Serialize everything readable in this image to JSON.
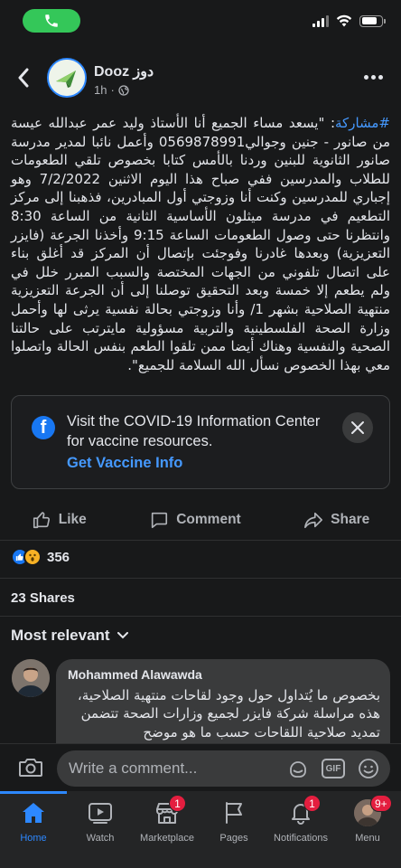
{
  "status_bar": {
    "call_active": true,
    "icons": [
      "phone-icon",
      "signal-icon",
      "wifi-icon",
      "battery-icon"
    ]
  },
  "post": {
    "page_name": "Dooz دوز",
    "time": "1h",
    "audience_icon": "globe-icon",
    "hashtag": "#مشاركة",
    "body": ": \"يسعد مساء الجميع أنا الأستاذ وليد عمر عبدالله عيسة من صانور - جنين وجوالي0569878991 وأعمل نائبا لمدير مدرسة صانور الثانوية للبنين وردنا بالأمس كتابا بخصوص تلقي الطعومات للطلاب والمدرسين ففي صباح هذا اليوم الاثنين 7/2/2022 وهو إجباري للمدرسين وكنت أنا وزوجتي أول المبادرين، فذهبنا إلى مركز التطعيم في مدرسة ميثلون الأساسية الثانية من الساعة 8:30 وانتظرنا حتى وصول الطعومات الساعة 9:15 وأخذنا الجرعة (فايزر التعزيزية) وبعدها غادرنا وفوجئت بإتصال أن المركز قد أغلق بناء على اتصال تلفوني من الجهات المختصة والسبب المبرر خلل في ولم يطعم إلا خمسة وبعد التحقيق توصلنا إلى أن الجرعة التعزيزية منتهية الصلاحية بشهر 1/ وأنا وزوجتي بحالة نفسية يرثى لها وأحمل وزارة الصحة الفلسطينية والتربية مسؤولية مايترتب على حالتنا الصحية والنفسية وهناك أيضا ممن تلقوا الطعم بنفس الحالة واتصلوا معي بهذا الخصوص نسأل الله السلامة للجميع\"."
  },
  "covid_card": {
    "text": "Visit the COVID-19 Information Center for vaccine resources.",
    "link": "Get Vaccine Info"
  },
  "actions": {
    "like": "Like",
    "comment": "Comment",
    "share": "Share"
  },
  "reactions": {
    "types": [
      "like",
      "wow"
    ],
    "count": "356"
  },
  "shares": "23 Shares",
  "sort_label": "Most relevant",
  "comment": {
    "author": "Mohammed Alawawda",
    "text": "بخصوص ما يُتداول حول وجود لقاحات منتهية الصلاحية، هذه مراسلة شركة فايزر لجميع وزارات الصحة تتضمن تمديد صلاحية اللقاحات حسب ما هو موضح"
  },
  "composer": {
    "placeholder": "Write a comment...",
    "gif": "GIF"
  },
  "nav": [
    {
      "label": "Home",
      "icon": "home-icon",
      "active": true,
      "badge": ""
    },
    {
      "label": "Watch",
      "icon": "watch-icon",
      "active": false,
      "badge": ""
    },
    {
      "label": "Marketplace",
      "icon": "marketplace-icon",
      "active": false,
      "badge": "1"
    },
    {
      "label": "Pages",
      "icon": "pages-icon",
      "active": false,
      "badge": ""
    },
    {
      "label": "Notifications",
      "icon": "bell-icon",
      "active": false,
      "badge": "1"
    },
    {
      "label": "Menu",
      "icon": "menu-avatar",
      "active": false,
      "badge": "9+"
    }
  ],
  "colors": {
    "background": "#18191a",
    "accent": "#2d88ff",
    "link": "#4599ff",
    "badge": "#e41e3f",
    "call_green": "#34c759"
  }
}
